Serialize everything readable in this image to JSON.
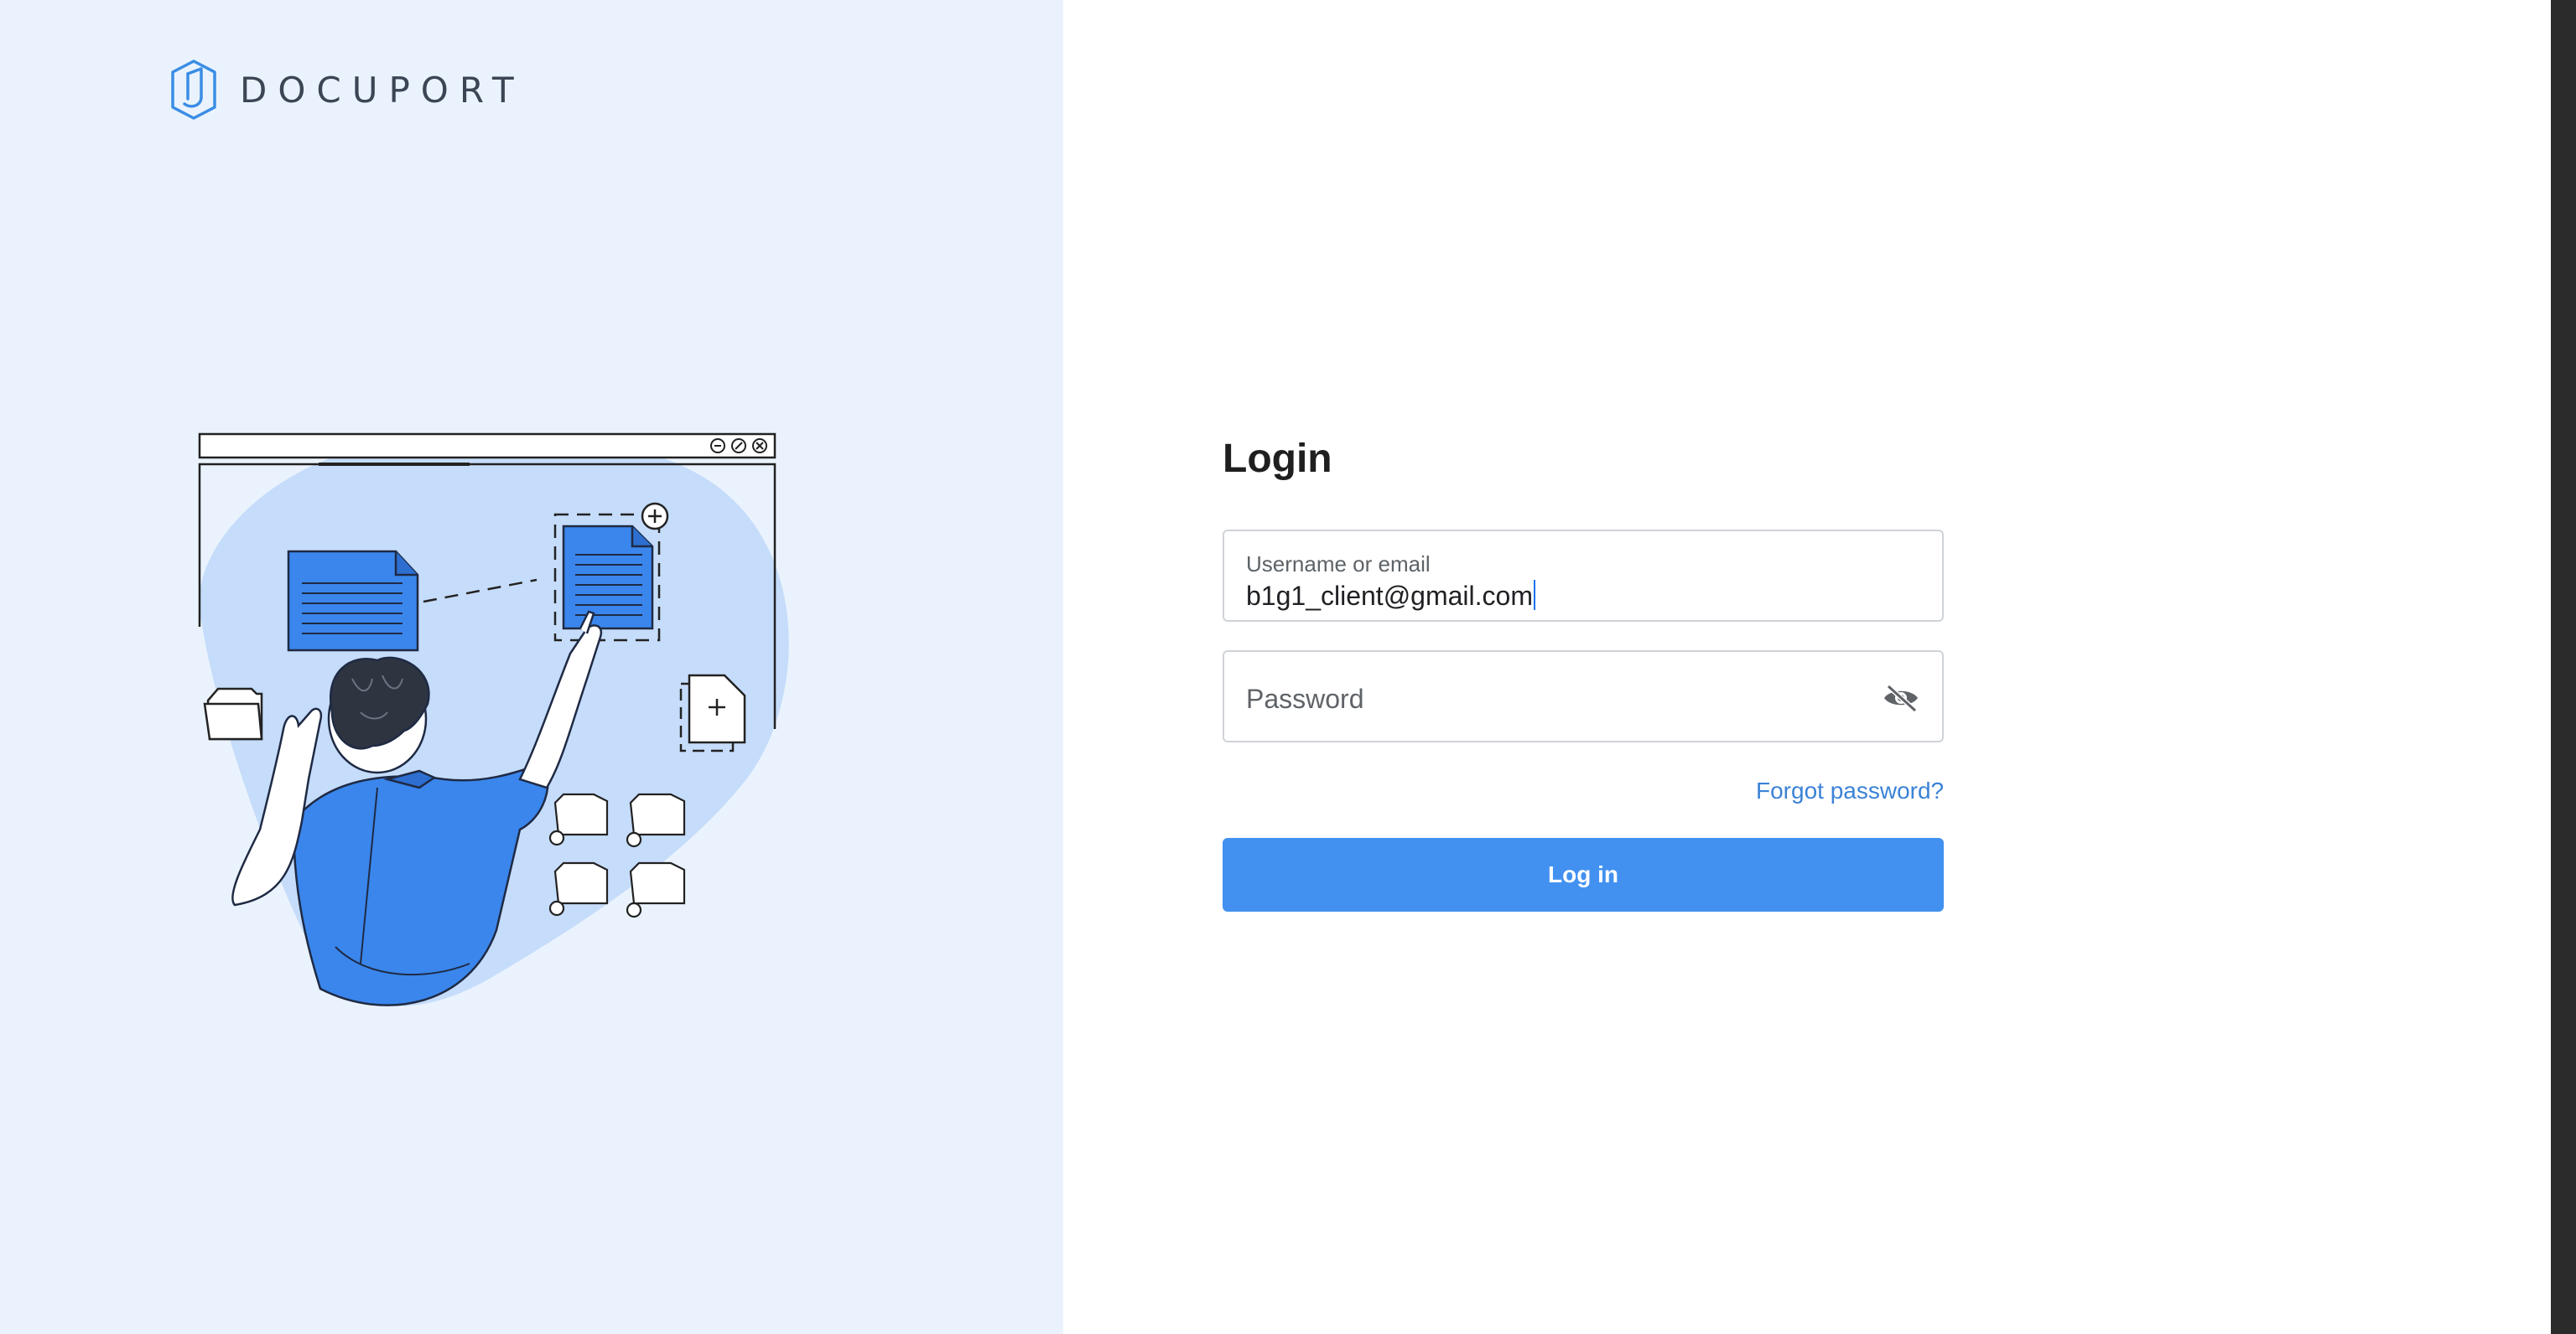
{
  "brand": {
    "name": "DOCUPORT",
    "accent_color": "#4291f0",
    "left_background": "#eaf3fd"
  },
  "login": {
    "title": "Login",
    "username": {
      "label": "Username or email",
      "value": "b1g1_client@gmail.com"
    },
    "password": {
      "placeholder": "Password",
      "toggle_icon": "eye-slash-icon"
    },
    "forgot_password_label": "Forgot password?",
    "submit_label": "Log in"
  },
  "illustration": {
    "subject": "person-organizing-documents"
  }
}
